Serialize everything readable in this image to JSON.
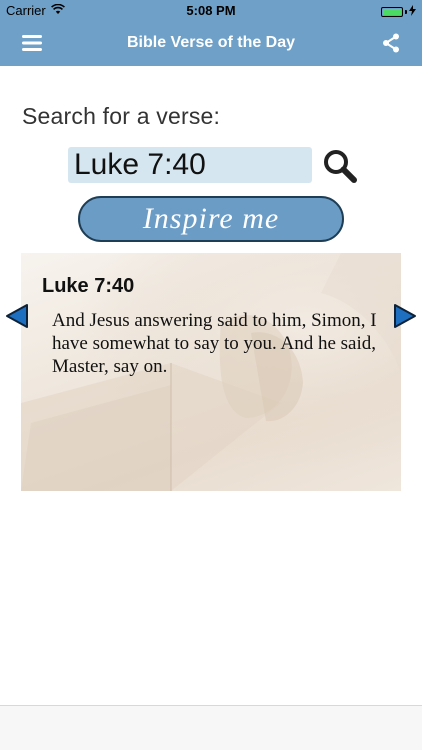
{
  "status_bar": {
    "carrier": "Carrier",
    "time": "5:08 PM",
    "battery_level": 1.0,
    "battery_color": "#4cd964"
  },
  "nav": {
    "title": "Bible Verse of the Day",
    "menu_icon": "hamburger-menu-icon",
    "share_icon": "share-icon",
    "background_color": "#6ea0c8"
  },
  "search": {
    "heading": "Search for a verse:",
    "value": "Luke 7:40",
    "icon": "magnifier-icon"
  },
  "inspire": {
    "label": "Inspire me",
    "color": "#6b9cc6"
  },
  "verse": {
    "reference": "Luke 7:40",
    "text": "And Jesus answering said to him, Simon, I have somewhat to say to you. And he said, Master, say on."
  },
  "navigation_arrows": {
    "left_icon": "arrow-left-icon",
    "right_icon": "arrow-right-icon",
    "color": "#1e6fc0"
  }
}
